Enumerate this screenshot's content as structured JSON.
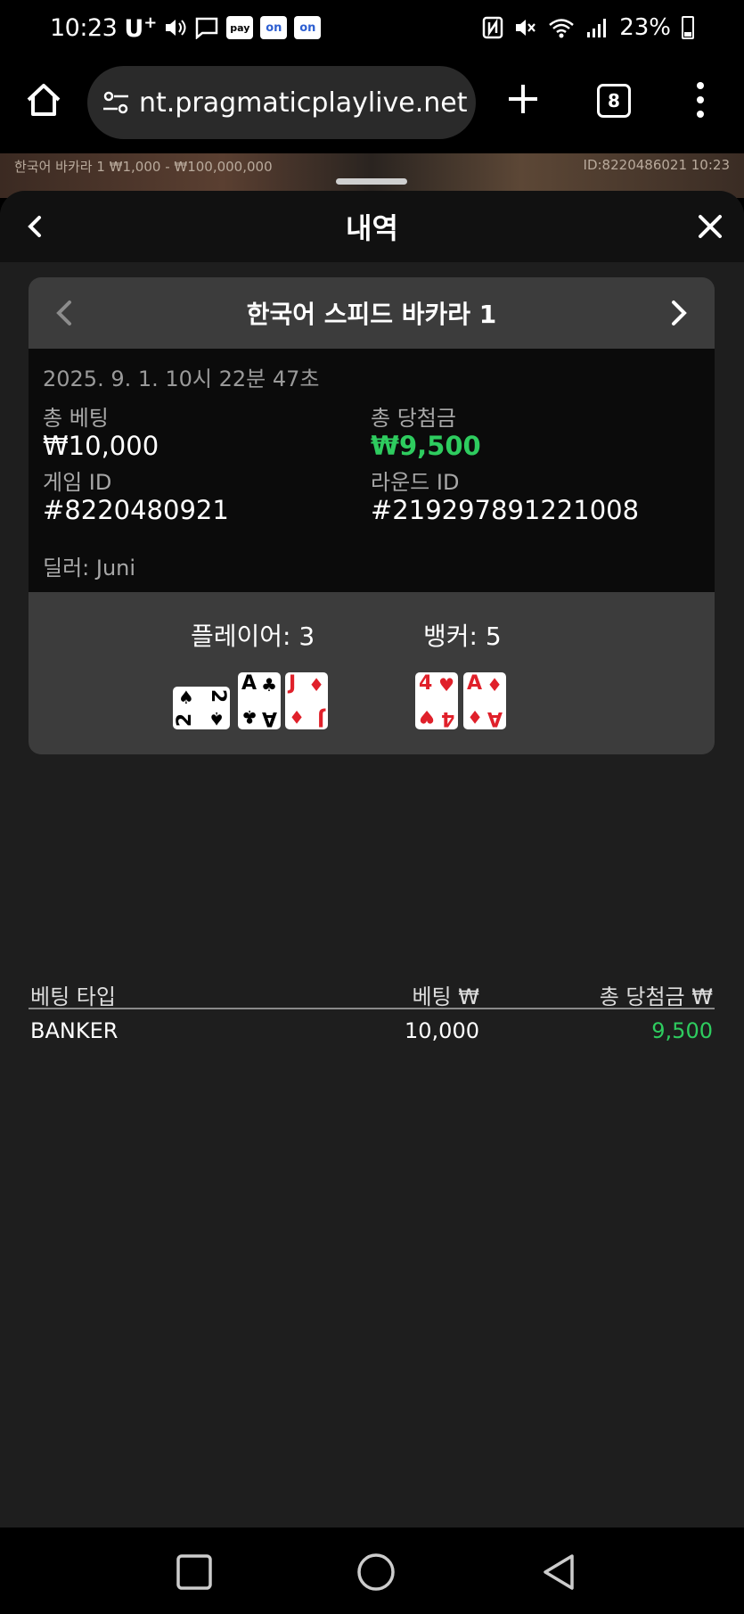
{
  "status_bar": {
    "time": "10:23",
    "carrier": "U",
    "carrier_sup": "+",
    "chip_pay": "pay",
    "chip_on1": "on",
    "chip_on2": "on",
    "battery": "23%",
    "icons": [
      "volume-icon",
      "message-icon",
      "nfc-icon",
      "mute-icon",
      "wifi-icon",
      "signal-icon",
      "battery-icon"
    ]
  },
  "browser": {
    "url": "nt.pragmaticplaylive.net",
    "tab_count": "8"
  },
  "game_strip": {
    "limits": "한국어 바카라 1 ₩1,000 - ₩100,000,000",
    "id_time": "ID:8220486021 10:23"
  },
  "panel": {
    "title": "내역"
  },
  "round": {
    "game_name": "한국어 스피드 바카라 1",
    "datetime": "2025. 9. 1. 10시 22분 47초",
    "total_bet_label": "총 베팅",
    "total_bet_value": "₩10,000",
    "total_win_label": "총 당첨금",
    "total_win_value": "₩9,500",
    "game_id_label": "게임 ID",
    "game_id_value": "#8220480921",
    "round_id_label": "라운드 ID",
    "round_id_value": "#219297891221008",
    "dealer": "딜러: Juni",
    "win_color": "#2ecc5f"
  },
  "hands": {
    "player_label": "플레이어: 3",
    "banker_label": "뱅커: 5",
    "player_cards": [
      {
        "rank": "2",
        "suit": "♠",
        "color": "black",
        "orientation": "sideways"
      },
      {
        "rank": "A",
        "suit": "♣",
        "color": "black",
        "orientation": "upright"
      },
      {
        "rank": "J",
        "suit": "♦",
        "color": "red",
        "orientation": "upright"
      }
    ],
    "banker_cards": [
      {
        "rank": "4",
        "suit": "♥",
        "color": "red",
        "orientation": "upright"
      },
      {
        "rank": "A",
        "suit": "♦",
        "color": "red",
        "orientation": "upright"
      }
    ]
  },
  "bets": {
    "headers": {
      "type": "베팅 타입",
      "bet": "베팅 ₩",
      "win": "총 당첨금 ₩"
    },
    "rows": [
      {
        "type": "BANKER",
        "bet": "10,000",
        "win": "9,500"
      }
    ]
  }
}
